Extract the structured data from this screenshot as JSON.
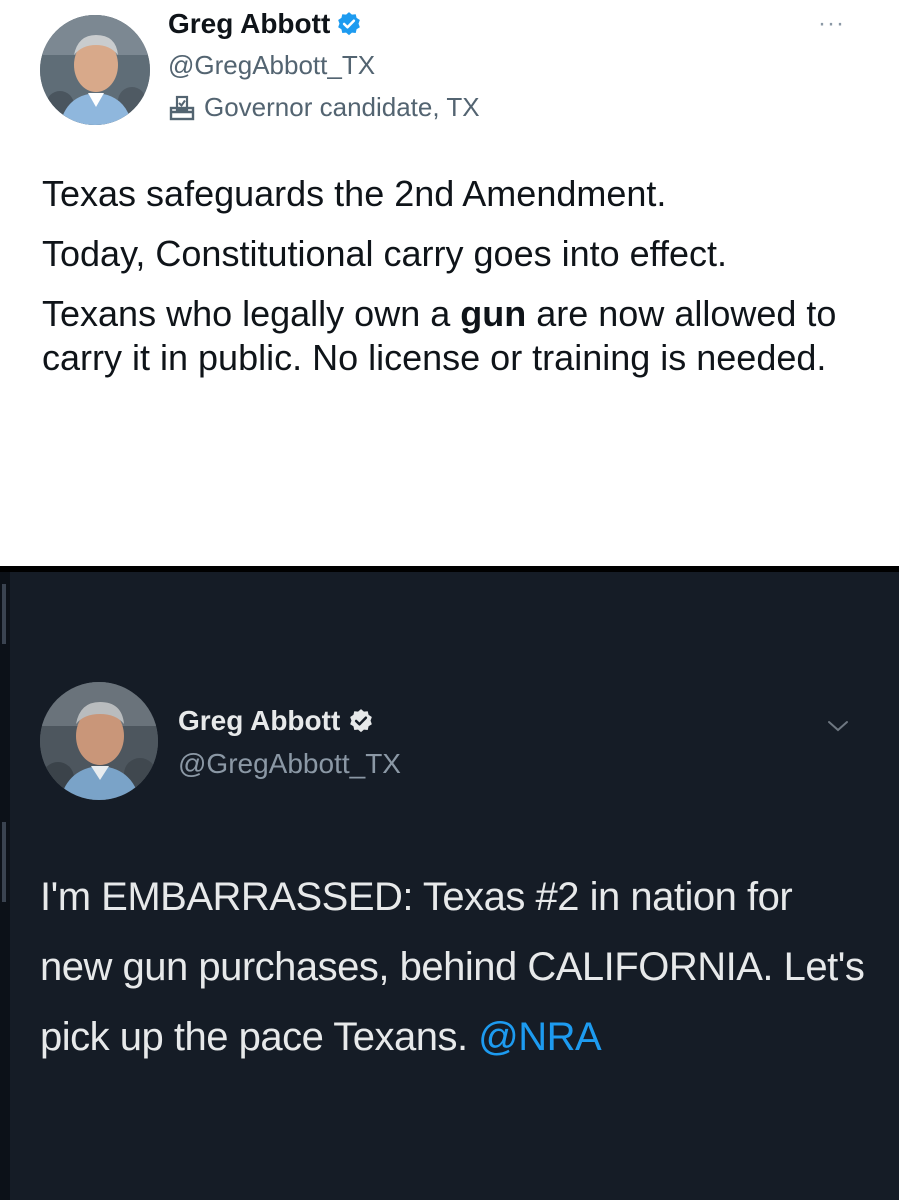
{
  "top_tweet": {
    "name": "Greg Abbott",
    "handle": "@GregAbbott_TX",
    "account_label": "Governor candidate, TX",
    "more": "···",
    "body": {
      "p1": "Texas safeguards the 2nd Amendment.",
      "p2": "Today, Constitutional carry goes into effect.",
      "p3_before": "Texans who legally own a ",
      "p3_bold": "gun",
      "p3_after": " are now allowed to carry it in public. No license or training is needed."
    }
  },
  "bottom_tweet": {
    "name": "Greg Abbott",
    "handle": "@GregAbbott_TX",
    "body_text": "I'm EMBARRASSED: Texas #2 in nation for new gun purchases, behind CALIFORNIA. Let's pick up the pace Texans. ",
    "mention": "@NRA"
  },
  "colors": {
    "verified": "#1d9bf0",
    "mention": "#1d9bf0",
    "dark_bg": "#151c26"
  },
  "icons": {
    "verified": "verified-badge-icon",
    "ballot": "ballot-box-icon",
    "more": "more-options-icon",
    "chevron": "chevron-down-icon"
  }
}
